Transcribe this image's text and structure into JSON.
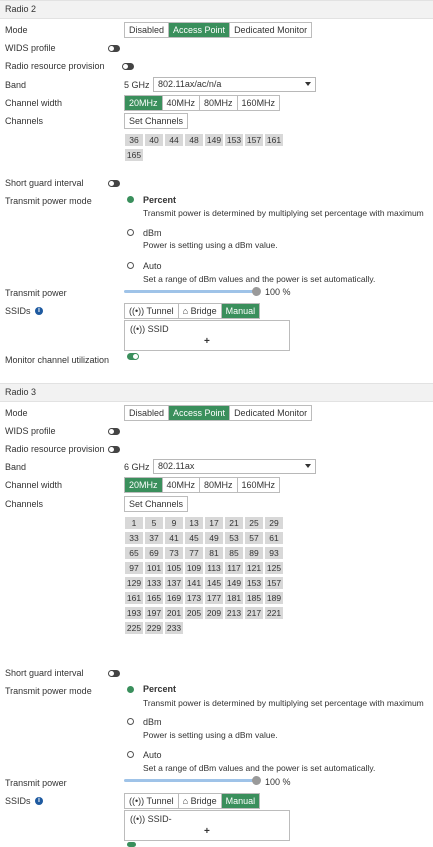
{
  "labels": {
    "mode": "Mode",
    "wids_profile": "WIDS profile",
    "radio_resource_provision": "Radio resource provision",
    "band": "Band",
    "channel_width": "Channel width",
    "channels": "Channels",
    "short_guard_interval": "Short guard interval",
    "transmit_power_mode": "Transmit power mode",
    "transmit_power": "Transmit power",
    "ssids": "SSIDs",
    "monitor_channel_utilization": "Monitor channel utilization"
  },
  "mode_options": [
    "Disabled",
    "Access Point",
    "Dedicated Monitor"
  ],
  "width_options": [
    "20MHz",
    "40MHz",
    "80MHz",
    "160MHz"
  ],
  "set_channels_label": "Set Channels",
  "ssid_mode_options": [
    "Tunnel",
    "Bridge",
    "Manual"
  ],
  "power_options": {
    "percent": {
      "label": "Percent",
      "desc": "Transmit power is determined by multiplying set percentage with maximum"
    },
    "dbm": {
      "label": "dBm",
      "desc": "Power is setting using a dBm value."
    },
    "auto": {
      "label": "Auto",
      "desc": "Set a range of dBm values and the power is set automatically."
    }
  },
  "radio2": {
    "title": "Radio 2",
    "mode_selected": "Access Point",
    "band_prefix": "5 GHz",
    "band_value": "802.11ax/ac/n/a",
    "width_selected": "20MHz",
    "channels": [
      "36",
      "40",
      "44",
      "48",
      "149",
      "153",
      "157",
      "161",
      "165"
    ],
    "power_mode": "Percent",
    "transmit_power_value": "100 %",
    "transmit_power_level": 1.0,
    "ssid_mode_selected": "Manual",
    "ssid_item": "SSID",
    "wids_profile": false,
    "radio_resource_provision": false,
    "short_guard_interval": false,
    "monitor_channel_utilization": true
  },
  "radio3": {
    "title": "Radio 3",
    "mode_selected": "Access Point",
    "band_prefix": "6 GHz",
    "band_value": "802.11ax",
    "width_selected": "20MHz",
    "channels": [
      "1",
      "5",
      "9",
      "13",
      "17",
      "21",
      "25",
      "29",
      "33",
      "37",
      "41",
      "45",
      "49",
      "53",
      "57",
      "61",
      "65",
      "69",
      "73",
      "77",
      "81",
      "85",
      "89",
      "93",
      "97",
      "101",
      "105",
      "109",
      "113",
      "117",
      "121",
      "125",
      "129",
      "133",
      "137",
      "141",
      "145",
      "149",
      "153",
      "157",
      "161",
      "165",
      "169",
      "173",
      "177",
      "181",
      "185",
      "189",
      "193",
      "197",
      "201",
      "205",
      "209",
      "213",
      "217",
      "221",
      "225",
      "229",
      "233"
    ],
    "power_mode": "Percent",
    "transmit_power_value": "100 %",
    "transmit_power_level": 1.0,
    "ssid_mode_selected": "Manual",
    "ssid_item": "SSID-",
    "wids_profile": false,
    "radio_resource_provision": false,
    "short_guard_interval": false
  },
  "icons": {
    "tunnel": "broadcast-icon",
    "bridge": "bridge-icon",
    "ssid": "broadcast-icon",
    "info": "info-icon",
    "add": "plus-icon"
  },
  "colors": {
    "accent": "#3a8f5c",
    "slider": "#9fc3e8",
    "chip": "#d8d8d8",
    "info": "#1e5aa0"
  }
}
